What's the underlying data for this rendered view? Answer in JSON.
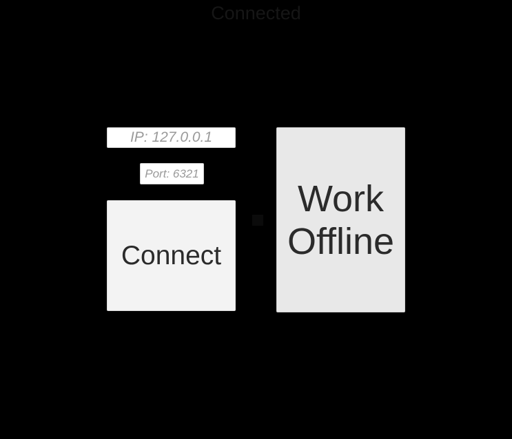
{
  "status": {
    "text": "Connected"
  },
  "connection": {
    "ip_value": "IP: 127.0.0.1",
    "port_value": "Port: 6321",
    "connect_label": "Connect"
  },
  "offline": {
    "label": "Work\nOffline"
  }
}
